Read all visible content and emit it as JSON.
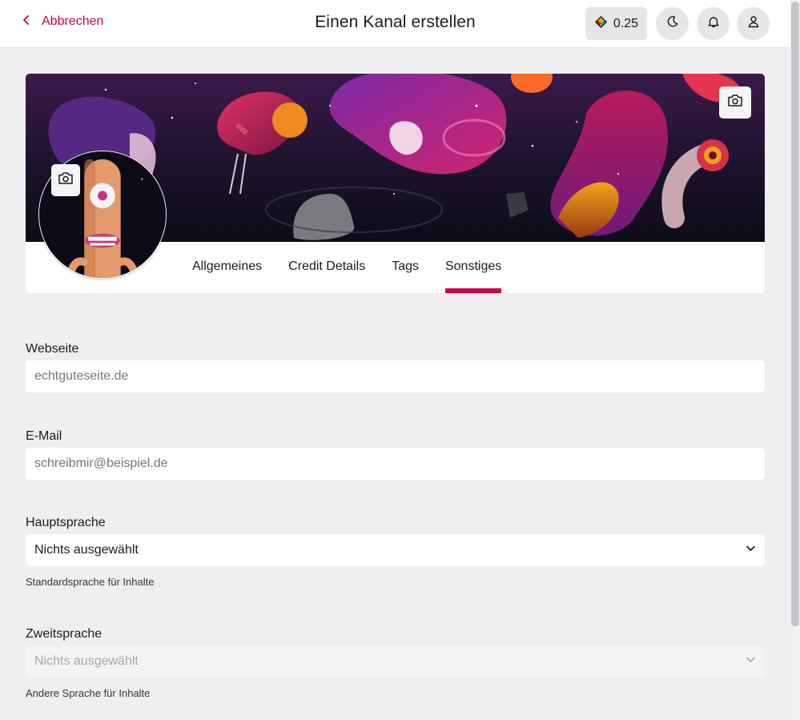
{
  "header": {
    "back_label": "Abbrechen",
    "title": "Einen Kanal erstellen",
    "credits": "0.25",
    "icons": [
      "back-chevron-icon",
      "credits-gem-icon",
      "moon-icon",
      "bell-icon",
      "user-icon"
    ]
  },
  "banner": {
    "upload_icon": "camera-icon"
  },
  "tabs": [
    {
      "label": "Allgemeines",
      "active": false
    },
    {
      "label": "Credit Details",
      "active": false
    },
    {
      "label": "Tags",
      "active": false
    },
    {
      "label": "Sonstiges",
      "active": true
    }
  ],
  "form": {
    "website": {
      "label": "Webseite",
      "value": "",
      "placeholder": "echtguteseite.de"
    },
    "email": {
      "label": "E-Mail",
      "value": "",
      "placeholder": "schreibmir@beispiel.de"
    },
    "main_language": {
      "label": "Hauptsprache",
      "value": "Nichts ausgewählt",
      "hint": "Standardsprache für Inhalte",
      "disabled": false
    },
    "second_language": {
      "label": "Zweitsprache",
      "value": "Nichts ausgewählt",
      "hint": "Andere Sprache für Inhalte",
      "disabled": true
    }
  },
  "colors": {
    "accent": "#c8004d",
    "background": "#efeff1",
    "surface": "#ffffff"
  }
}
